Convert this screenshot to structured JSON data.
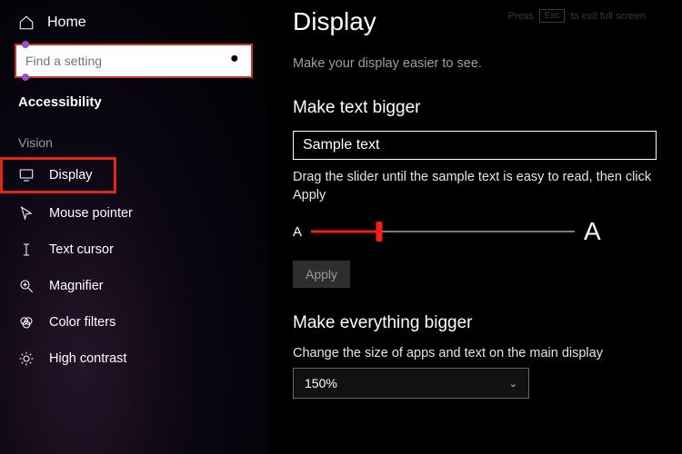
{
  "sidebar": {
    "home": "Home",
    "search_placeholder": "Find a setting",
    "category": "Accessibility",
    "vision_label": "Vision",
    "items": [
      {
        "label": "Display"
      },
      {
        "label": "Mouse pointer"
      },
      {
        "label": "Text cursor"
      },
      {
        "label": "Magnifier"
      },
      {
        "label": "Color filters"
      },
      {
        "label": "High contrast"
      }
    ]
  },
  "exit_hint": {
    "press": "Press",
    "key": "Esc",
    "rest": "to exit full screen"
  },
  "main": {
    "title": "Display",
    "intro": "Make your display easier to see.",
    "text_bigger": {
      "heading": "Make text bigger",
      "sample": "Sample text",
      "instruction": "Drag the slider until the sample text is easy to read, then click Apply",
      "small_a": "A",
      "big_a": "A",
      "apply": "Apply"
    },
    "everything_bigger": {
      "heading": "Make everything bigger",
      "description": "Change the size of apps and text on the main display",
      "value": "150%"
    }
  }
}
